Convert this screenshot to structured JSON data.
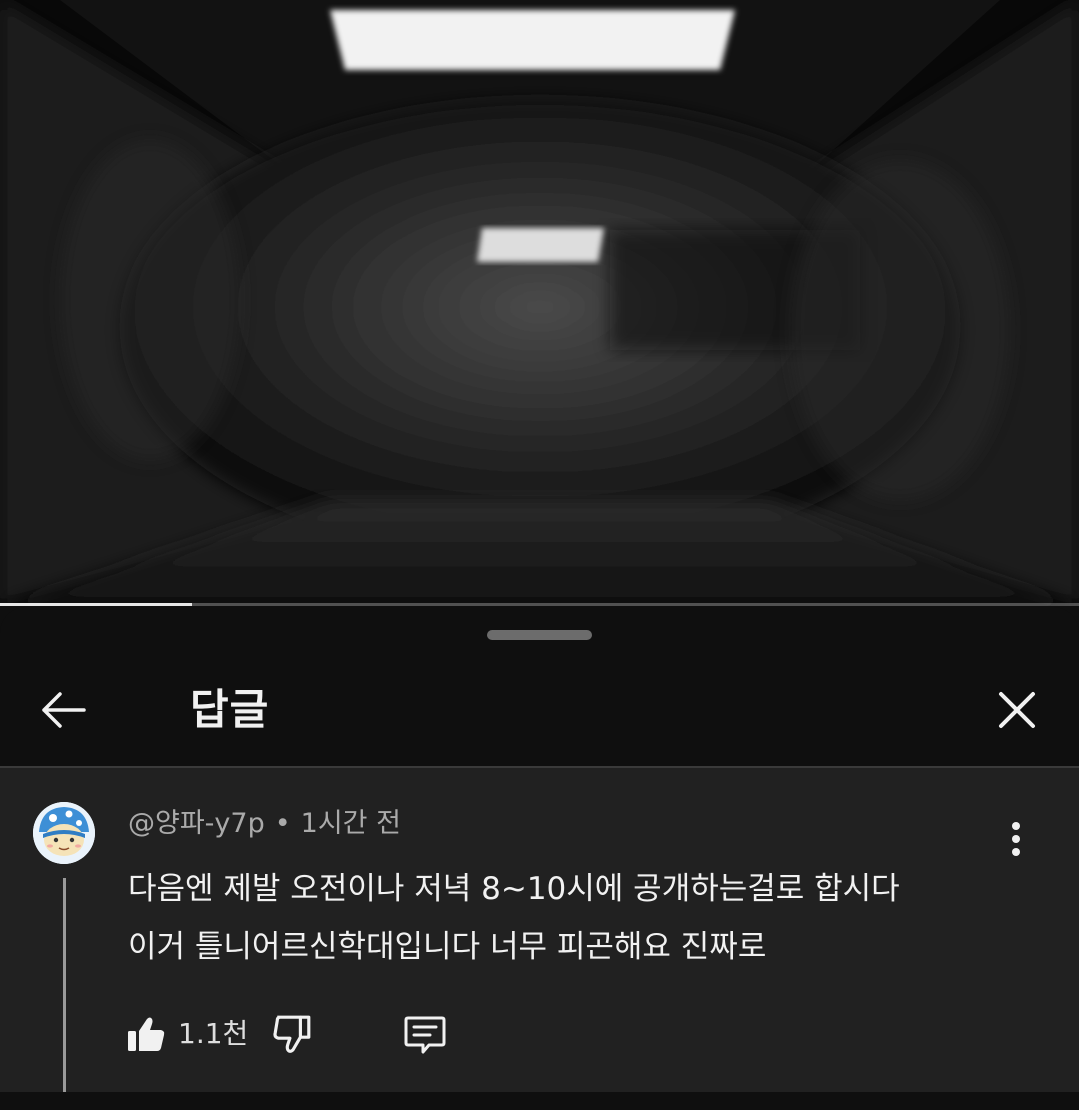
{
  "header": {
    "title": "답글"
  },
  "video": {
    "progress_percent": 17.8
  },
  "comment": {
    "author": "@양파-y7p",
    "separator": "•",
    "time": "1시간 전",
    "text_line_1": "다음엔 제발 오전이나 저녁 8~10시에 공개하는걸로 합시다",
    "text_line_2": "이거 틀니어르신학대입니다 너무 피곤해요 진짜로",
    "like_count": "1.1천"
  },
  "icons": {
    "back": "arrow-left-icon",
    "close": "close-icon",
    "more": "more-vertical-icon",
    "like": "thumbs-up-icon",
    "dislike": "thumbs-down-icon",
    "reply": "comment-icon"
  },
  "colors": {
    "background": "#0f0f0f",
    "comment_background": "#212121",
    "text_primary": "#f1f1f1",
    "text_secondary": "#aaaaaa"
  }
}
